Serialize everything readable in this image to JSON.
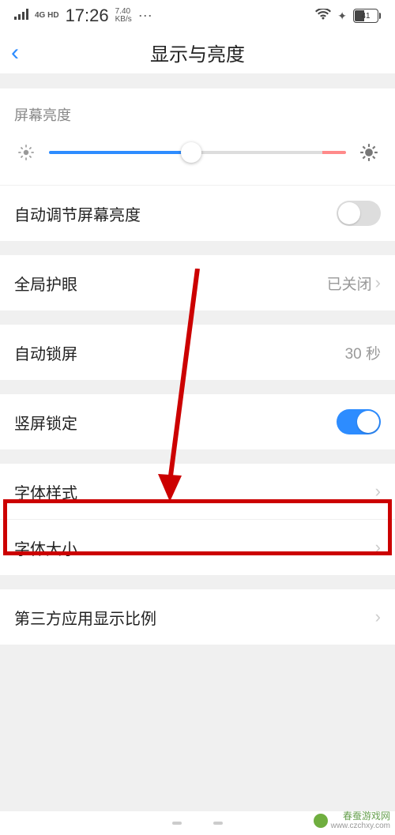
{
  "status": {
    "net_type": "4G HD",
    "time": "17:26",
    "speed_val": "7.40",
    "speed_unit": "KB/s",
    "battery_pct": "41"
  },
  "header": {
    "title": "显示与亮度"
  },
  "brightness": {
    "label": "屏幕亮度",
    "slider_pct": 48,
    "min_icon": "sun-small",
    "max_icon": "sun-large"
  },
  "rows": {
    "auto_brightness": {
      "label": "自动调节屏幕亮度",
      "toggle": false
    },
    "eye_protect": {
      "label": "全局护眼",
      "value": "已关闭"
    },
    "auto_lock": {
      "label": "自动锁屏",
      "value": "30 秒"
    },
    "portrait_lock": {
      "label": "竖屏锁定",
      "toggle": true
    },
    "font_style": {
      "label": "字体样式"
    },
    "font_size": {
      "label": "字体大小"
    },
    "third_party": {
      "label": "第三方应用显示比例"
    }
  },
  "watermark": {
    "name": "春蚕游戏网",
    "url": "www.czchxy.com"
  },
  "colors": {
    "accent": "#2d8cff",
    "highlight": "#c00"
  }
}
